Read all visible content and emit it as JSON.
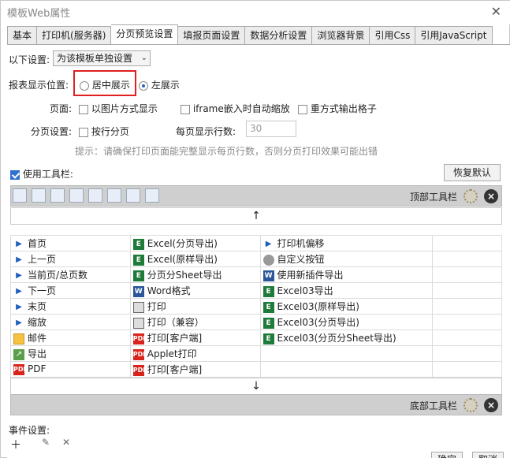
{
  "window": {
    "title": "模板Web属性"
  },
  "tabs": [
    {
      "label": "基本"
    },
    {
      "label": "打印机(服务器)"
    },
    {
      "label": "分页预览设置"
    },
    {
      "label": "填报页面设置"
    },
    {
      "label": "数据分析设置"
    },
    {
      "label": "浏览器背景"
    },
    {
      "label": "引用Css"
    },
    {
      "label": "引用JavaScript"
    }
  ],
  "settings": {
    "mode_label": "以下设置:",
    "mode_value": "为该模板单独设置",
    "position_label": "报表显示位置:",
    "position_center": "居中展示",
    "position_left": "左展示",
    "page_label": "页面:",
    "page_opt1": "以图片方式显示",
    "page_opt2": "iframe嵌入时自动缩放",
    "page_opt3": "重方式输出格子",
    "paging_label": "分页设置:",
    "paging_opt": "按行分页",
    "rows_label": "每页显示行数:",
    "rows_value": "30",
    "hint": "提示：请确保打印页面能完整显示每页行数，否则分页打印效果可能出错"
  },
  "toolbar": {
    "use_label": "使用工具栏:",
    "restore": "恢复默认",
    "top_label": "顶部工具栏",
    "bottom_label": "底部工具栏",
    "up_arrow": "↑",
    "down_arrow": "↓"
  },
  "items": [
    [
      "首页",
      "Excel(分页导出)",
      "打印机偏移"
    ],
    [
      "上一页",
      "Excel(原样导出)",
      "自定义按钮"
    ],
    [
      "当前页/总页数",
      "分页分Sheet导出",
      "使用新插件导出"
    ],
    [
      "下一页",
      "Word格式",
      "Excel03导出"
    ],
    [
      "末页",
      "打印",
      "Excel03(原样导出)"
    ],
    [
      "缩放",
      "打印（兼容）",
      "Excel03(分页导出)"
    ],
    [
      "邮件",
      "打印[客户端]",
      "Excel03(分页分Sheet导出)"
    ],
    [
      "导出",
      "Applet打印",
      ""
    ],
    [
      "PDF",
      "打印[客户端]",
      ""
    ]
  ],
  "events": {
    "label": "事件设置:"
  },
  "buttons": {
    "ok": "确定",
    "cancel": "取消"
  }
}
